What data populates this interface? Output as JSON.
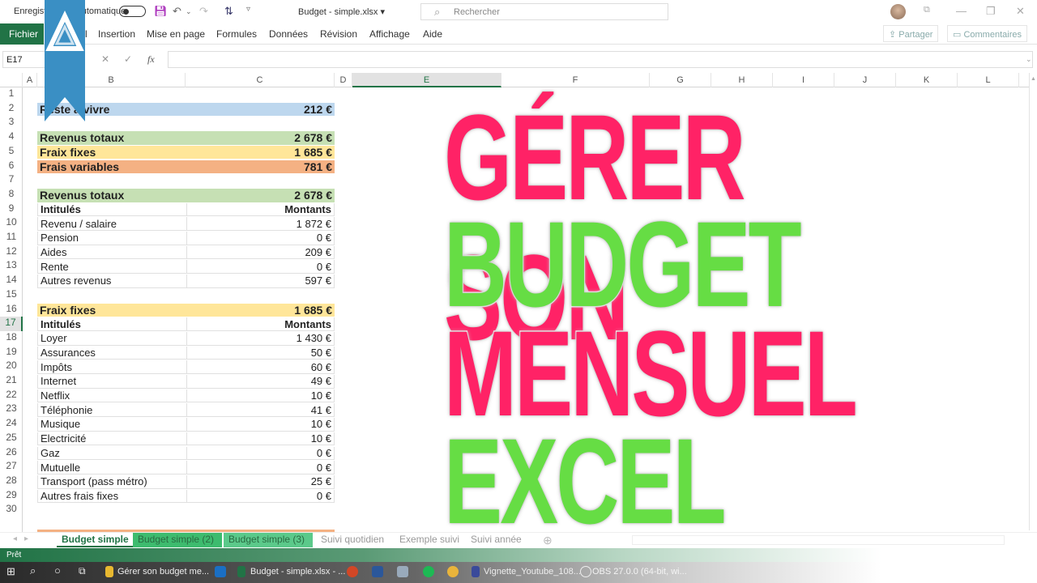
{
  "titlebar": {
    "autosave_label": "Enregistrement automatique",
    "doc_title": "Budget - simple.xlsx",
    "search_placeholder": "Rechercher"
  },
  "ribbon": {
    "file_tab": "Fichier",
    "tabs": [
      "Accueil",
      "Insertion",
      "Mise en page",
      "Formules",
      "Données",
      "Révision",
      "Affichage",
      "Aide"
    ],
    "share_label": "Partager",
    "comments_label": "Commentaires"
  },
  "formula_bar": {
    "name_box": "E17",
    "fx_label": "fx",
    "content": ""
  },
  "columns": [
    "A",
    "B",
    "C",
    "D",
    "E",
    "F",
    "G",
    "H",
    "I",
    "J",
    "K",
    "L"
  ],
  "selected_column": "E",
  "selected_row": 17,
  "rows": [
    "1",
    "2",
    "3",
    "4",
    "5",
    "6",
    "7",
    "8",
    "9",
    "10",
    "11",
    "12",
    "13",
    "14",
    "15",
    "16",
    "17",
    "18",
    "19",
    "20",
    "21",
    "22",
    "23",
    "24",
    "25",
    "26",
    "27",
    "28",
    "29",
    "30"
  ],
  "summary": {
    "reste": {
      "label": "Reste à vivre",
      "value": "212 €"
    },
    "revenus": {
      "label": "Revenus totaux",
      "value": "2 678 €"
    },
    "fixes": {
      "label": "Fraix fixes",
      "value": "1 685 €"
    },
    "variables": {
      "label": "Frais variables",
      "value": "781 €"
    }
  },
  "revenus_table": {
    "title": "Revenus totaux",
    "total": "2 678 €",
    "col_label": "Intitulés",
    "col_amount": "Montants",
    "rows": [
      {
        "label": "Revenu / salaire",
        "amount": "1 872 €"
      },
      {
        "label": "Pension",
        "amount": "0 €"
      },
      {
        "label": "Aides",
        "amount": "209 €"
      },
      {
        "label": "Rente",
        "amount": "0 €"
      },
      {
        "label": "Autres revenus",
        "amount": "597 €"
      }
    ]
  },
  "fixes_table": {
    "title": "Fraix fixes",
    "total": "1 685 €",
    "col_label": "Intitulés",
    "col_amount": "Montants",
    "rows": [
      {
        "label": "Loyer",
        "amount": "1 430 €"
      },
      {
        "label": "Assurances",
        "amount": "50 €"
      },
      {
        "label": "Impôts",
        "amount": "60 €"
      },
      {
        "label": "Internet",
        "amount": "49 €"
      },
      {
        "label": "Netflix",
        "amount": "10 €"
      },
      {
        "label": "Téléphonie",
        "amount": "41 €"
      },
      {
        "label": "Musique",
        "amount": "10 €"
      },
      {
        "label": "Electricité",
        "amount": "10 €"
      },
      {
        "label": "Gaz",
        "amount": "0 €"
      },
      {
        "label": "Mutuelle",
        "amount": "0 €"
      },
      {
        "label": "Transport (pass métro)",
        "amount": "25 €"
      },
      {
        "label": "Autres frais fixes",
        "amount": "0 €"
      }
    ]
  },
  "overlay": {
    "line1": "GÉRER SON",
    "line2": "BUDGET",
    "line3": "MENSUEL",
    "line4": "EXCEL"
  },
  "colors": {
    "pink": "#ff2266",
    "green": "#66dd44",
    "excel_green": "#217346",
    "blue_row": "#bdd7ee",
    "green_row": "#c6e0b4",
    "yellow_row": "#ffe699",
    "orange_row": "#f4b183"
  },
  "sheet_tabs": [
    "Budget simple",
    "Budget simple (2)",
    "Budget simple (3)",
    "Suivi quotidien",
    "Exemple suivi",
    "Suivi année"
  ],
  "status": "Prêt",
  "taskbar": {
    "items": [
      "Gérer son budget me...",
      "Budget - simple.xlsx - ...",
      "Vignette_Youtube_108...",
      "OBS 27.0.0 (64-bit, wi..."
    ]
  }
}
